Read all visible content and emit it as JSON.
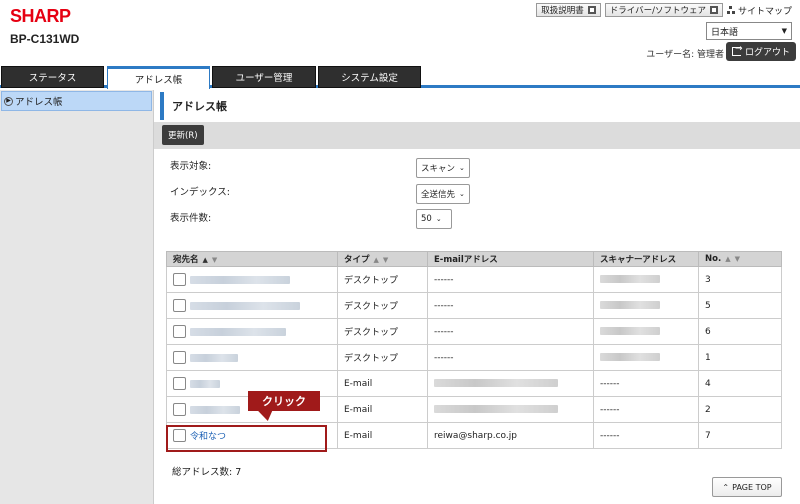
{
  "header": {
    "brand": "SHARP",
    "model": "BP-C131WD",
    "links": [
      "取扱説明書",
      "ドライバー/ソフトウェア"
    ],
    "sitemap": "サイトマップ",
    "language": "日本語",
    "user_label": "ユーザー名: 管理者",
    "logout": "ログアウト"
  },
  "tabs": [
    {
      "label": "ステータス"
    },
    {
      "label": "アドレス帳"
    },
    {
      "label": "ユーザー管理"
    },
    {
      "label": "システム設定"
    }
  ],
  "sidebar": {
    "items": [
      {
        "label": "アドレス帳"
      }
    ]
  },
  "main": {
    "title": "アドレス帳",
    "refresh": "更新(R)",
    "filters": [
      {
        "label": "表示対象:",
        "value": "スキャン"
      },
      {
        "label": "インデックス:",
        "value": "全送信先"
      },
      {
        "label": "表示件数:",
        "value": "50"
      }
    ],
    "columns": [
      "宛先名",
      "タイプ",
      "E-mailアドレス",
      "スキャナーアドレス",
      "No."
    ],
    "rows": [
      {
        "type": "デスクトップ",
        "email": "------",
        "no": "3"
      },
      {
        "type": "デスクトップ",
        "email": "------",
        "no": "5"
      },
      {
        "type": "デスクトップ",
        "email": "------",
        "no": "6"
      },
      {
        "type": "デスクトップ",
        "email": "------",
        "no": "1"
      },
      {
        "type": "E-mail",
        "scanner": "------",
        "no": "4"
      },
      {
        "type": "E-mail",
        "scanner": "------",
        "no": "2"
      },
      {
        "name": "令和なつ",
        "type": "E-mail",
        "email": "reiwa@sharp.co.jp",
        "scanner": "------",
        "no": "7"
      }
    ],
    "total": "総アドレス数:  7",
    "page_top": "PAGE TOP",
    "callout": "クリック"
  }
}
